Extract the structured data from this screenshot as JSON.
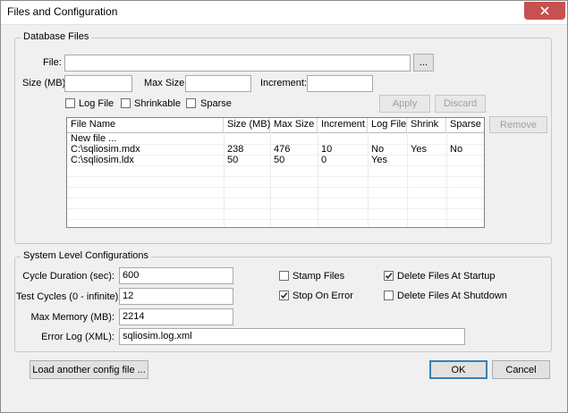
{
  "window": {
    "title": "Files and Configuration",
    "close_icon": "close-icon"
  },
  "database_files": {
    "legend": "Database Files",
    "file_label": "File:",
    "file_value": "",
    "browse_label": "...",
    "size_label": "Size (MB):",
    "size_value": "",
    "max_size_label": "Max Size:",
    "max_size_value": "",
    "increment_label": "Increment:",
    "increment_value": "",
    "log_file_label": "Log File",
    "log_file_checked": false,
    "shrinkable_label": "Shrinkable",
    "shrinkable_checked": false,
    "sparse_label": "Sparse",
    "sparse_checked": false,
    "apply_label": "Apply",
    "discard_label": "Discard",
    "remove_label": "Remove",
    "columns": [
      "File Name",
      "Size (MB)",
      "Max Size",
      "Increment",
      "Log File",
      "Shrink",
      "Sparse"
    ],
    "rows": [
      [
        "New file ...",
        "",
        "",
        "",
        "",
        "",
        ""
      ],
      [
        "C:\\sqliosim.mdx",
        "238",
        "476",
        "10",
        "No",
        "Yes",
        "No"
      ],
      [
        "C:\\sqliosim.ldx",
        "50",
        "50",
        "0",
        "Yes",
        "",
        ""
      ]
    ]
  },
  "system_config": {
    "legend": "System Level Configurations",
    "cycle_duration_label": "Cycle Duration (sec):",
    "cycle_duration_value": "600",
    "test_cycles_label": "Test Cycles (0 - infinite):",
    "test_cycles_value": "12",
    "max_memory_label": "Max Memory (MB):",
    "max_memory_value": "2214",
    "error_log_label": "Error Log (XML):",
    "error_log_value": "sqliosim.log.xml",
    "stamp_files_label": "Stamp Files",
    "stamp_files_checked": false,
    "stop_on_error_label": "Stop On Error",
    "stop_on_error_checked": true,
    "delete_at_startup_label": "Delete Files At Startup",
    "delete_at_startup_checked": true,
    "delete_at_shutdown_label": "Delete Files At Shutdown",
    "delete_at_shutdown_checked": false
  },
  "footer": {
    "load_config_label": "Load another config file ...",
    "ok_label": "OK",
    "cancel_label": "Cancel"
  },
  "colors": {
    "close_button": "#c75050",
    "default_button_border": "#3c7fb1",
    "dialog_background": "#f0f0f0"
  }
}
